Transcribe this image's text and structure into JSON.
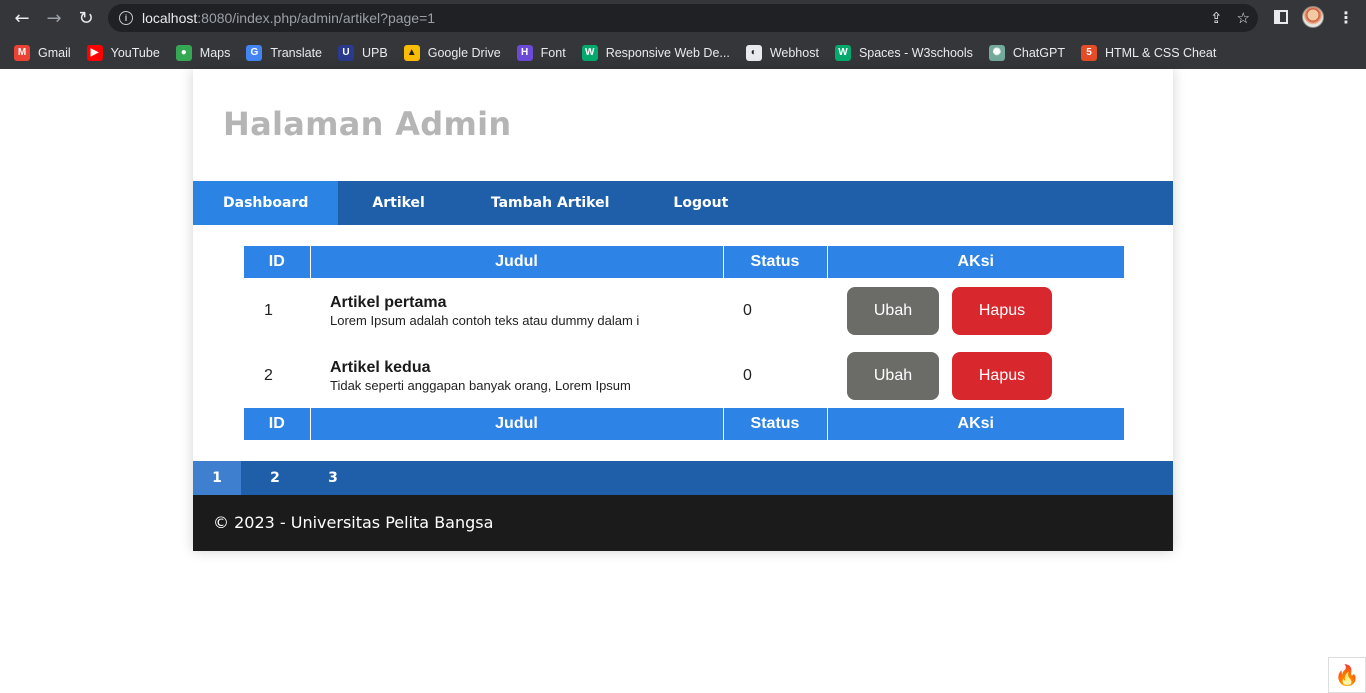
{
  "browser": {
    "url_host": "localhost",
    "url_rest": ":8080/index.php/admin/artikel?page=1",
    "bookmarks": [
      {
        "label": "Gmail",
        "icon": "gmail-icon",
        "color": "#ea4335",
        "glyph": "M"
      },
      {
        "label": "YouTube",
        "icon": "youtube-icon",
        "color": "#ff0000",
        "glyph": "▶"
      },
      {
        "label": "Maps",
        "icon": "maps-icon",
        "color": "#34a853",
        "glyph": "●"
      },
      {
        "label": "Translate",
        "icon": "translate-icon",
        "color": "#4285f4",
        "glyph": "G"
      },
      {
        "label": "UPB",
        "icon": "upb-icon",
        "color": "#2a3a8c",
        "glyph": "U"
      },
      {
        "label": "Google Drive",
        "icon": "google-drive-icon",
        "color": "#fbbc04",
        "glyph": "▲"
      },
      {
        "label": "Font",
        "icon": "font-icon",
        "color": "#6c4ad8",
        "glyph": "H"
      },
      {
        "label": "Responsive Web De...",
        "icon": "w3schools-icon",
        "color": "#04aa6d",
        "glyph": "W"
      },
      {
        "label": "Webhost",
        "icon": "webhost-icon",
        "color": "#e8eaed",
        "glyph": "◐"
      },
      {
        "label": "Spaces - W3schools",
        "icon": "w3schools-spaces-icon",
        "color": "#04aa6d",
        "glyph": "W"
      },
      {
        "label": "ChatGPT",
        "icon": "chatgpt-icon",
        "color": "#74aa9c",
        "glyph": "✺"
      },
      {
        "label": "HTML & CSS Cheat",
        "icon": "html-css-icon",
        "color": "#e44d26",
        "glyph": "5"
      }
    ]
  },
  "header": {
    "title": "Halaman Admin"
  },
  "nav": {
    "dashboard": "Dashboard",
    "artikel": "Artikel",
    "tambah": "Tambah Artikel",
    "logout": "Logout"
  },
  "table": {
    "headers": {
      "id": "ID",
      "judul": "Judul",
      "status": "Status",
      "aksi": "AKsi"
    },
    "rows": [
      {
        "id": "1",
        "title": "Artikel pertama",
        "excerpt": "Lorem Ipsum adalah contoh teks atau dummy dalam i",
        "status": "0",
        "edit": "Ubah",
        "delete": "Hapus"
      },
      {
        "id": "2",
        "title": "Artikel kedua",
        "excerpt": "Tidak seperti anggapan banyak orang, Lorem Ipsum",
        "status": "0",
        "edit": "Ubah",
        "delete": "Hapus"
      }
    ]
  },
  "pager": {
    "p1": "1",
    "p2": "2",
    "p3": "3"
  },
  "footer": {
    "text": "© 2023 - Universitas Pelita Bangsa"
  }
}
